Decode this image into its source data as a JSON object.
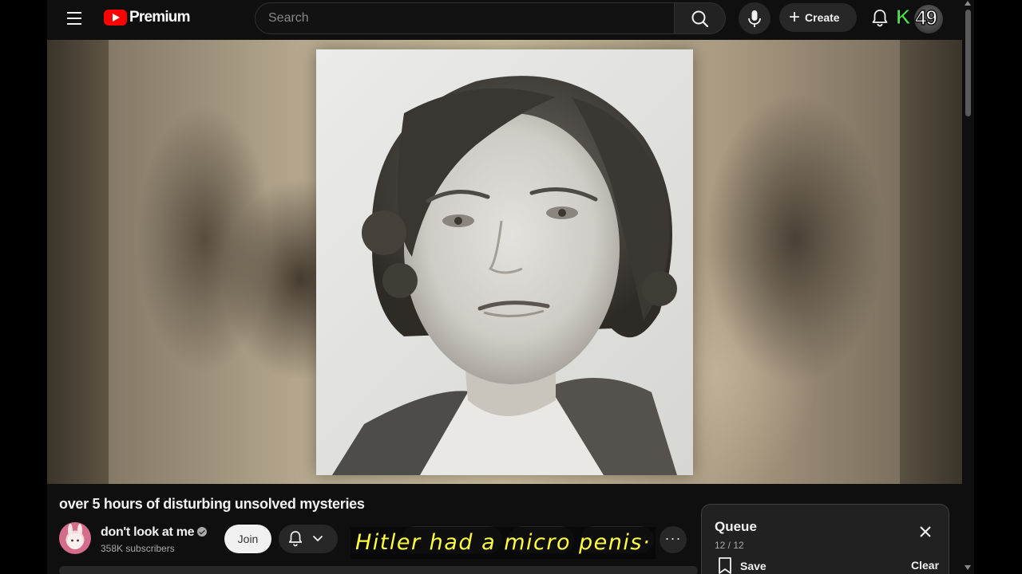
{
  "header": {
    "brand_label": "Premium",
    "search_placeholder": "Search",
    "create_label": "Create",
    "channel_letter": "K",
    "badge_number": "49",
    "icons": [
      "menu-icon",
      "youtube-logo-icon",
      "search-icon",
      "mic-icon",
      "plus-icon",
      "bell-icon"
    ]
  },
  "video": {
    "title": "over 5 hours of disturbing unsolved mysteries",
    "subtitle": "Hitler had a micro penis·"
  },
  "channel": {
    "name": "don't look at me",
    "subscribers": "358K subscribers",
    "join_label": "Join",
    "icons": [
      "verified-icon",
      "bell-icon",
      "chevron-down-icon",
      "more-icon"
    ]
  },
  "queue": {
    "title": "Queue",
    "count": "12 / 12",
    "save_label": "Save",
    "clear_label": "Clear",
    "icons": [
      "close-icon",
      "bookmark-icon"
    ]
  },
  "colors": {
    "background": "#0f0f0f",
    "brand_red": "#ff0000",
    "subtitle_text": "#ffff3c",
    "channel_letter": "#4ee34e"
  }
}
